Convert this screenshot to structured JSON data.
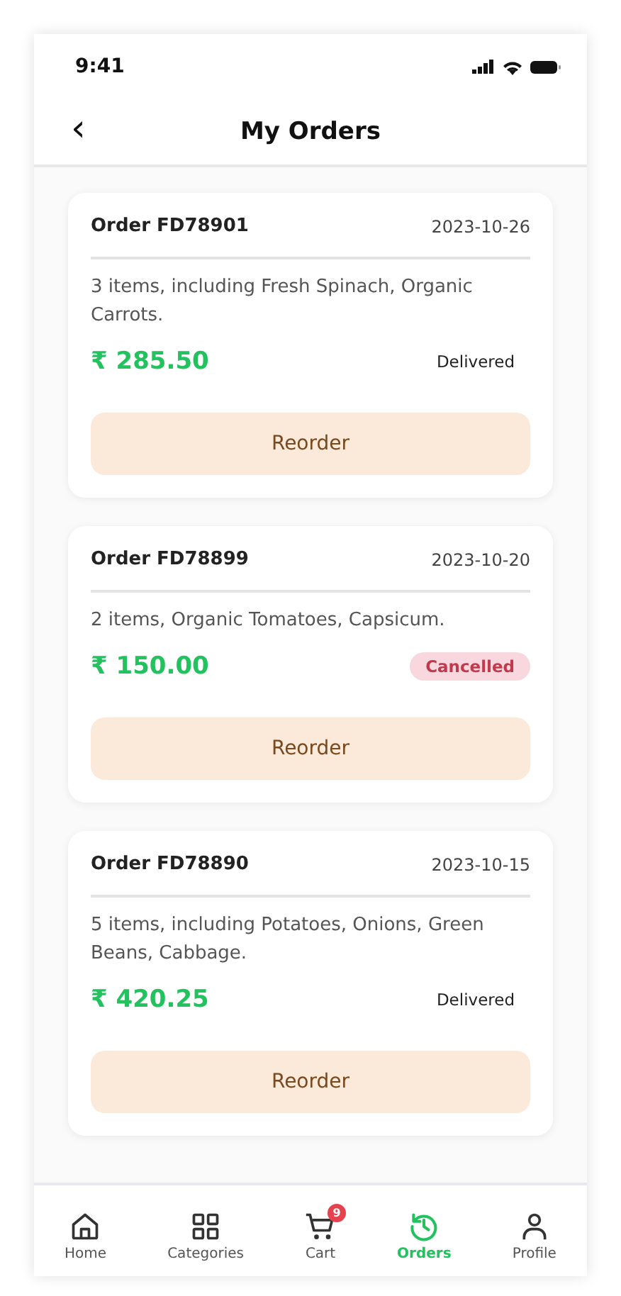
{
  "status_bar": {
    "time": "9:41"
  },
  "header": {
    "back": "‹",
    "title": "My Orders"
  },
  "orders": [
    {
      "number": "Order FD78901",
      "date": "2023-10-26",
      "summary": "3 items, including Fresh Spinach, Organic Carrots.",
      "total": "₹ 285.50",
      "status": "Delivered",
      "kind": "delivered",
      "action": "Reorder"
    },
    {
      "number": "Order FD78899",
      "date": "2023-10-20",
      "summary": "2 items, Organic Tomatoes, Capsicum.",
      "total": "₹ 150.00",
      "status": "Cancelled",
      "kind": "cancelled",
      "action": "Reorder"
    },
    {
      "number": "Order FD78890",
      "date": "2023-10-15",
      "summary": "5 items, including Potatoes, Onions, Green Beans, Cabbage.",
      "total": "₹ 420.25",
      "status": "Delivered",
      "kind": "delivered",
      "action": "Reorder"
    }
  ],
  "nav": [
    {
      "label": "Home",
      "kind": "home",
      "selected": false
    },
    {
      "label": "Categories",
      "kind": "grid",
      "selected": false
    },
    {
      "label": "Cart",
      "kind": "cart",
      "selected": false,
      "badge": "9"
    },
    {
      "label": "Orders",
      "kind": "history",
      "selected": true
    },
    {
      "label": "Profile",
      "kind": "person",
      "selected": false
    }
  ]
}
